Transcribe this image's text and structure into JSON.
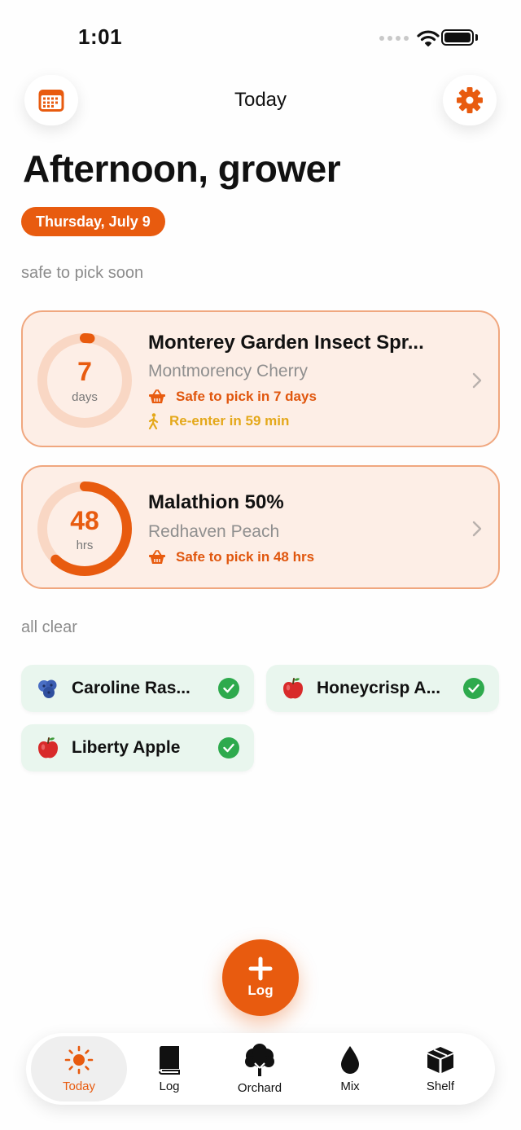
{
  "status_bar": {
    "time": "1:01"
  },
  "header": {
    "title": "Today"
  },
  "greeting": "Afternoon, grower",
  "date": "Thursday, July 9",
  "sections": {
    "soon": "safe to pick soon",
    "clear": "all clear"
  },
  "pending": [
    {
      "count": "7",
      "unit": "days",
      "progress": 0.02,
      "title": "Monterey Garden Insect Spr...",
      "crop": "Montmorency Cherry",
      "pick_text": "Safe to pick in 7 days",
      "reenter_text": "Re-enter in 59 min"
    },
    {
      "count": "48",
      "unit": "hrs",
      "progress": 0.62,
      "title": "Malathion 50%",
      "crop": "Redhaven Peach",
      "pick_text": "Safe to pick in 48 hrs"
    }
  ],
  "clear": [
    {
      "label": "Caroline Ras...",
      "icon": "blueberry-icon"
    },
    {
      "label": "Honeycrisp A...",
      "icon": "apple-icon"
    },
    {
      "label": "Liberty Apple",
      "icon": "apple-icon"
    }
  ],
  "fab": {
    "label": "Log"
  },
  "tabs": [
    {
      "label": "Today",
      "icon": "sun-icon",
      "active": true
    },
    {
      "label": "Log",
      "icon": "book-icon"
    },
    {
      "label": "Orchard",
      "icon": "tree-icon"
    },
    {
      "label": "Mix",
      "icon": "drop-icon"
    },
    {
      "label": "Shelf",
      "icon": "box-icon"
    }
  ],
  "colors": {
    "accent": "#e85b0f",
    "card_bg": "#fdeee6",
    "clear_bg": "#e9f6ee",
    "check": "#2eaa4d"
  }
}
